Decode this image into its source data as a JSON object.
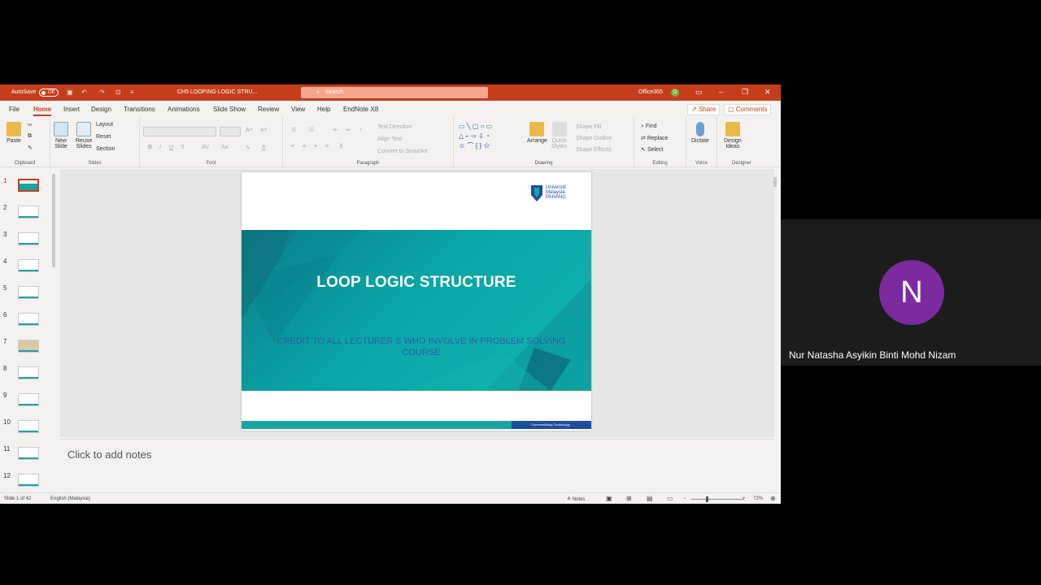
{
  "titlebar": {
    "autosave": "AutoSave",
    "autosave_state": "Off",
    "doc_title": "CH5 LOOPING LOGIC STRU...",
    "search_placeholder": "Search",
    "account": "Office365",
    "account_initial": "O"
  },
  "tabs": [
    "File",
    "Home",
    "Insert",
    "Design",
    "Transitions",
    "Animations",
    "Slide Show",
    "Review",
    "View",
    "Help",
    "EndNote X8"
  ],
  "actions": {
    "share": "Share",
    "comments": "Comments"
  },
  "ribbon": {
    "clipboard": {
      "label": "Clipboard",
      "paste": "Paste"
    },
    "slides": {
      "label": "Slides",
      "new_slide_1": "New",
      "new_slide_2": "Slide",
      "reuse_1": "Reuse",
      "reuse_2": "Slides",
      "layout": "Layout",
      "reset": "Reset",
      "section": "Section"
    },
    "font": {
      "label": "Font"
    },
    "paragraph": {
      "label": "Paragraph",
      "text_direction": "Text Direction",
      "align_text": "Align Text",
      "smartart": "Convert to SmartArt"
    },
    "drawing": {
      "label": "Drawing",
      "arrange": "Arrange",
      "quick_1": "Quick",
      "quick_2": "Styles",
      "fill": "Shape Fill",
      "outline": "Shape Outline",
      "effects": "Shape Effects"
    },
    "editing": {
      "label": "Editing",
      "find": "Find",
      "replace": "Replace",
      "select": "Select"
    },
    "voice": {
      "label": "Voice",
      "dictate": "Dictate"
    },
    "designer": {
      "label": "Designer",
      "ideas_1": "Design",
      "ideas_2": "Ideas"
    }
  },
  "thumbnails": [
    "1",
    "2",
    "3",
    "4",
    "5",
    "6",
    "7",
    "8",
    "9",
    "10",
    "11",
    "12"
  ],
  "slide": {
    "title": "LOOP LOGIC STRUCTURE",
    "credit_line1": "CREDIT TO ALL LECTURER S WHO INVOLVE IN PROBLEM SOLVING",
    "credit_line2": "COURSE",
    "logo_line1": "Universiti",
    "logo_line2": "Malaysia",
    "logo_line3": "PAHANG",
    "footer": "Communitising Technology"
  },
  "notes_placeholder": "Click to add notes",
  "status": {
    "slide_count": "Slide 1 of 42",
    "language": "English (Malaysia)",
    "notes": "Notes",
    "zoom": "72%"
  },
  "participant": {
    "initial": "N",
    "name": "Nur Natasha Asyikin Binti Mohd Nizam"
  },
  "colors": {
    "accent": "#c43e1c",
    "teal": "#1aa3a3",
    "navy": "#1b4f9c",
    "avatar": "#7b2b9e"
  }
}
